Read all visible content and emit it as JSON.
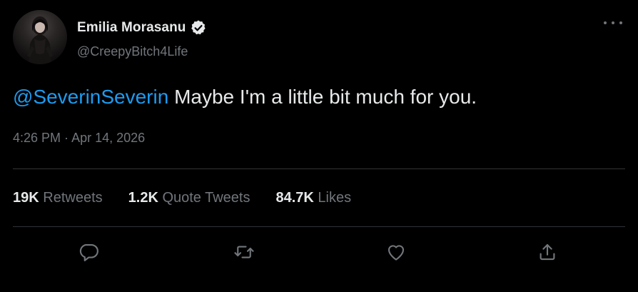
{
  "author": {
    "name": "Emilia Morasanu",
    "handle": "@CreepyBitch4Life",
    "verified": true
  },
  "tweet": {
    "mention": "@SeverinSeverin",
    "body": " Maybe I'm a little bit much for you.",
    "time": "4:26 PM",
    "separator": " · ",
    "date": "Apr 14, 2026"
  },
  "stats": {
    "retweets_count": "19K",
    "retweets_label": " Retweets",
    "quotes_count": "1.2K",
    "quotes_label": " Quote Tweets",
    "likes_count": "84.7K",
    "likes_label": " Likes"
  },
  "icons": {
    "more": "more-horizontal-icon",
    "verified": "verified-badge-icon",
    "reply": "reply-icon",
    "retweet": "retweet-icon",
    "like": "heart-icon",
    "share": "share-icon"
  },
  "colors": {
    "background": "#000000",
    "text": "#e7e9ea",
    "secondary": "#71767b",
    "accent": "#1d9bf0",
    "divider": "#2f3336"
  }
}
